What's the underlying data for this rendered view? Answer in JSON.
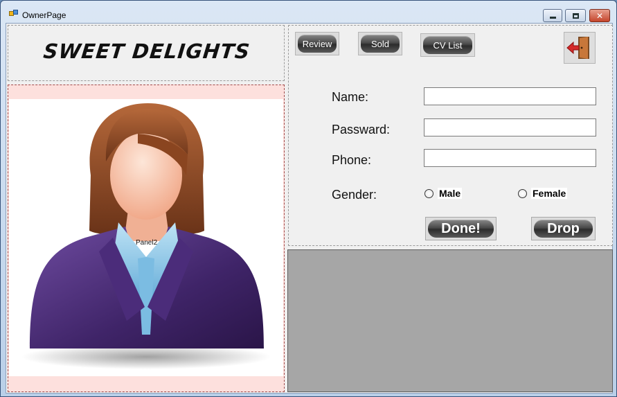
{
  "window": {
    "title": "OwnerPage",
    "close_glyph": "✕"
  },
  "brand": {
    "title": "SWEET DELIGHTS"
  },
  "photo_panel": {
    "label": "Panel2",
    "image": "woman-avatar-icon"
  },
  "toolbar": {
    "review_label": "Review",
    "sold_label": "Sold",
    "cv_list_label": "CV List",
    "exit_icon": "exit-door-icon"
  },
  "form": {
    "name_label": "Name:",
    "name_value": "",
    "password_label": "Passward:",
    "password_value": "",
    "phone_label": "Phone:",
    "phone_value": "",
    "gender_label": "Gender:",
    "gender_options": [
      "Male",
      "Female"
    ],
    "done_label": "Done!",
    "drop_label": "Drop"
  },
  "colors": {
    "photo_panel_bg": "#fde0dd",
    "gray_panel_bg": "#a6a6a6",
    "exit_arrow": "#d42a2a",
    "door": "#c8773a"
  }
}
